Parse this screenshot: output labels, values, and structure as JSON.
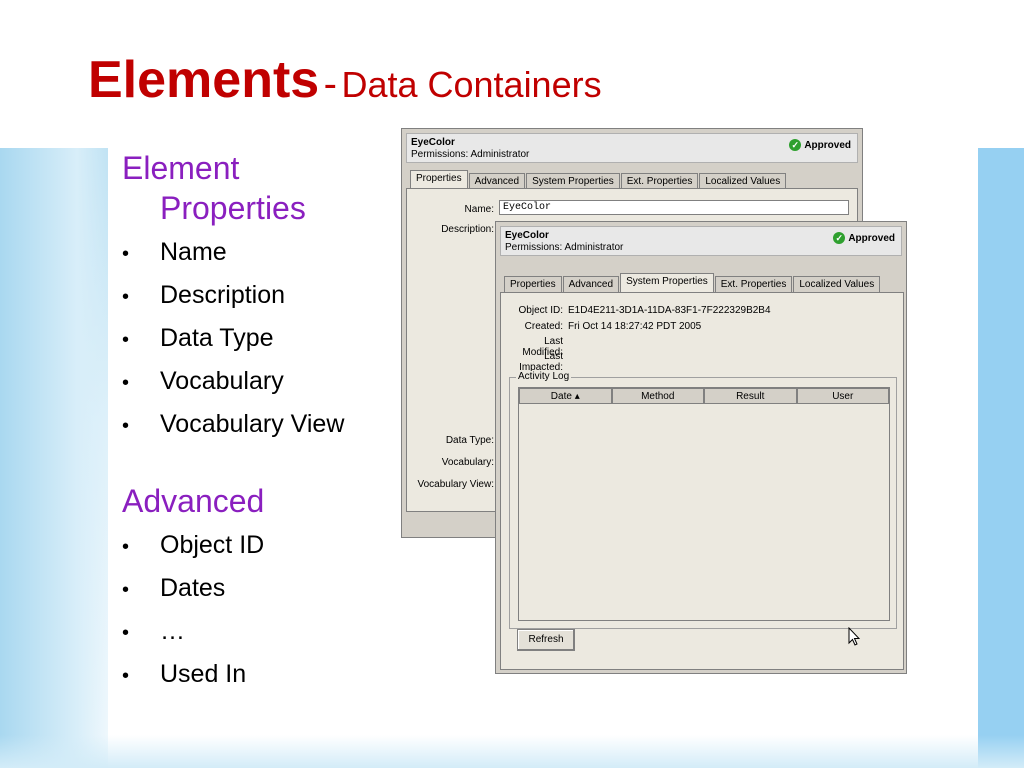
{
  "slide": {
    "title_main": "Elements",
    "title_sep": "-",
    "title_sub": "Data Containers"
  },
  "sections": [
    {
      "heading_line1": "Element",
      "heading_line2": "Properties",
      "items": [
        "Name",
        "Description",
        "Data Type",
        "Vocabulary",
        "Vocabulary View"
      ]
    },
    {
      "heading_line1": "Advanced",
      "items": [
        "Object ID",
        "Dates",
        "…",
        "Used In"
      ]
    }
  ],
  "bullet_char": "•",
  "dialog_back": {
    "element_name": "EyeColor",
    "permissions": "Permissions: Administrator",
    "status": "Approved",
    "tabs": [
      "Properties",
      "Advanced",
      "System Properties",
      "Ext. Properties",
      "Localized Values"
    ],
    "active_tab": "Properties",
    "fields": {
      "name_label": "Name:",
      "name_value": "EyeColor",
      "description_label": "Description:",
      "data_type_label": "Data Type:",
      "vocabulary_label": "Vocabulary:",
      "vocabulary_view_label": "Vocabulary View:"
    }
  },
  "dialog_front": {
    "element_name": "EyeColor",
    "permissions": "Permissions: Administrator",
    "status": "Approved",
    "tabs": [
      "Properties",
      "Advanced",
      "System Properties",
      "Ext. Properties",
      "Localized Values"
    ],
    "active_tab": "System Properties",
    "fields": {
      "object_id_label": "Object ID:",
      "object_id_value": "E1D4E211-3D1A-11DA-83F1-7F222329B2B4",
      "created_label": "Created:",
      "created_value": "Fri Oct 14 18:27:42 PDT 2005",
      "last_modified_label": "Last Modified:",
      "last_impacted_label": "Last Impacted:"
    },
    "activity_log": {
      "title": "Activity Log",
      "columns": [
        "Date",
        "Method",
        "Result",
        "User"
      ],
      "sort_indicator": "▴",
      "rows": []
    },
    "refresh_button": "Refresh"
  },
  "icons": {
    "approved": "check-circle-icon",
    "cursor": "mouse-pointer-icon"
  },
  "colors": {
    "title": "#c00000",
    "heading": "#8a1fbf",
    "approved_check": "#2fa02f",
    "dialog_bg": "#d4d0c8",
    "side_band": "#96d0f2"
  }
}
